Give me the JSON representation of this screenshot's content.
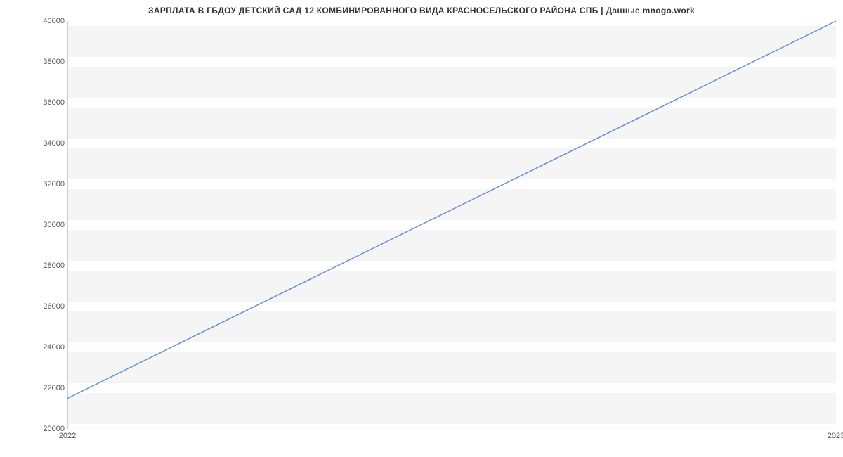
{
  "chart_data": {
    "type": "line",
    "title": "ЗАРПЛАТА В ГБДОУ ДЕТСКИЙ САД 12 КОМБИНИРОВАННОГО ВИДА КРАСНОСЕЛЬСКОГО РАЙОНА СПБ | Данные mnogo.work",
    "x": [
      "2022",
      "2023"
    ],
    "values": [
      21500,
      40000
    ],
    "xlabel": "",
    "ylabel": "",
    "ylim": [
      20000,
      40000
    ],
    "y_ticks": [
      20000,
      22000,
      24000,
      26000,
      28000,
      30000,
      32000,
      34000,
      36000,
      38000,
      40000
    ],
    "x_ticks": [
      "2022",
      "2023"
    ],
    "line_color": "#6b8fd4"
  }
}
